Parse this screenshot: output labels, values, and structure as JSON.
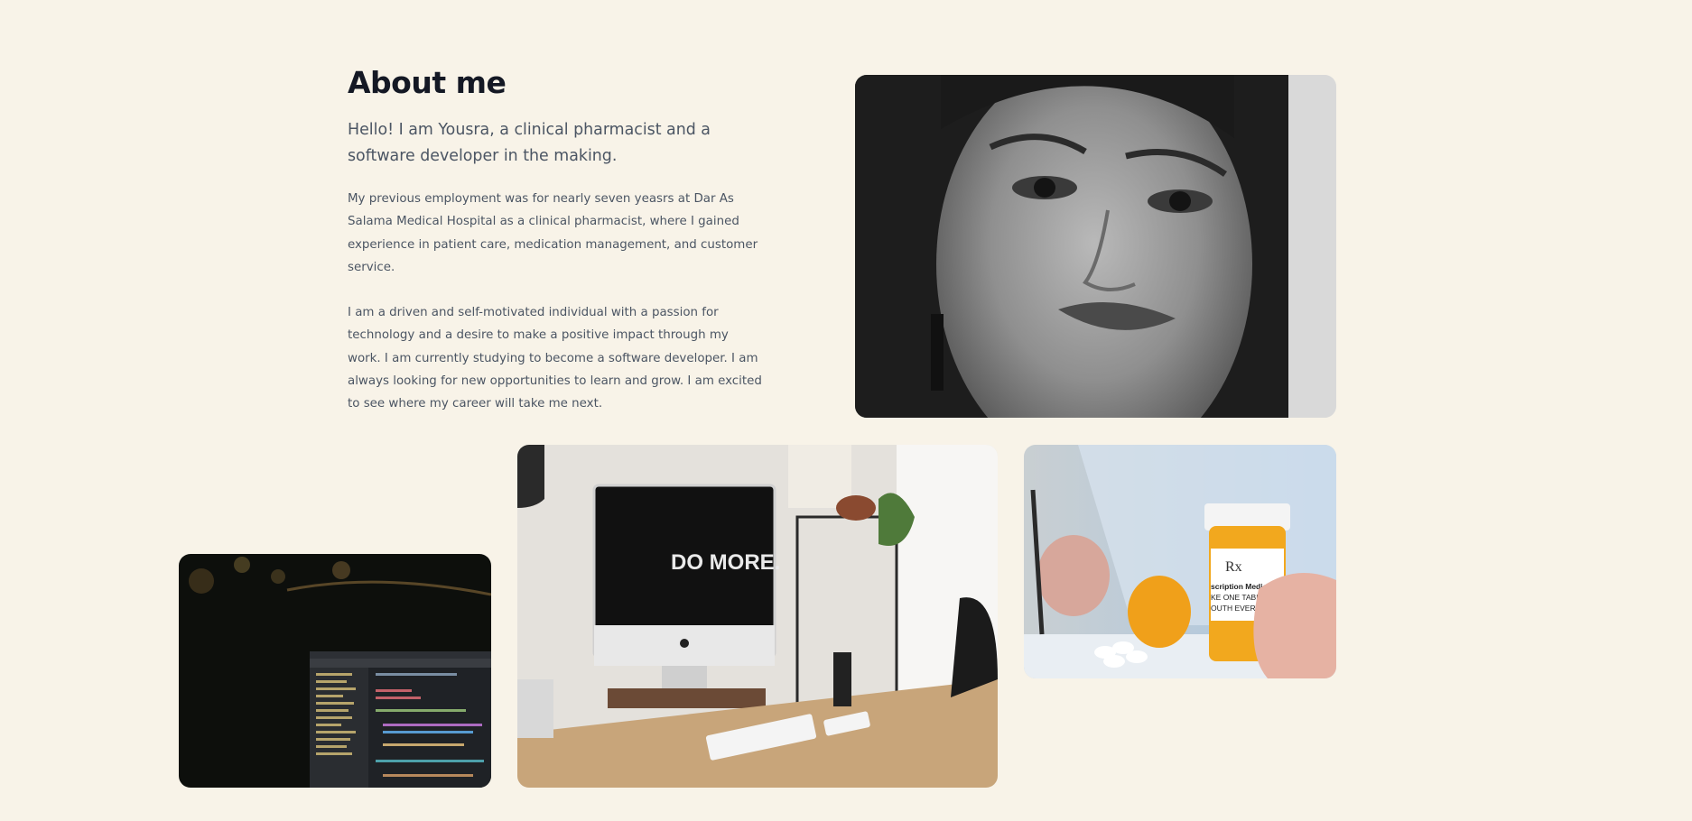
{
  "about": {
    "title": "About me",
    "lead": "Hello! I am Yousra, a clinical pharmacist and a software developer in the making.",
    "paragraphs": [
      "My previous employment was for nearly seven yeasrs at Dar As Salama Medical Hospital as a clinical pharmacist, where I gained experience in patient care, medication management, and customer service.",
      "I am a driven and self-motivated individual with a passion for technology and a desire to make a positive impact through my work. I am currently studying to become a software developer. I am always looking for new opportunities to learn and grow. I am excited to see where my career will take me next."
    ]
  },
  "images": {
    "portrait": "portrait-photo",
    "code": "laptop-code-photo",
    "desk": "desk-workspace-photo",
    "desk_screen_text": "DO MORE.",
    "pills": "prescription-bottle-photo",
    "pill_label_rx": "Rx",
    "pill_label_line1": "scription Medica",
    "pill_label_line2": "KE ONE TABLET",
    "pill_label_line3": "OUTH EVERY D"
  }
}
